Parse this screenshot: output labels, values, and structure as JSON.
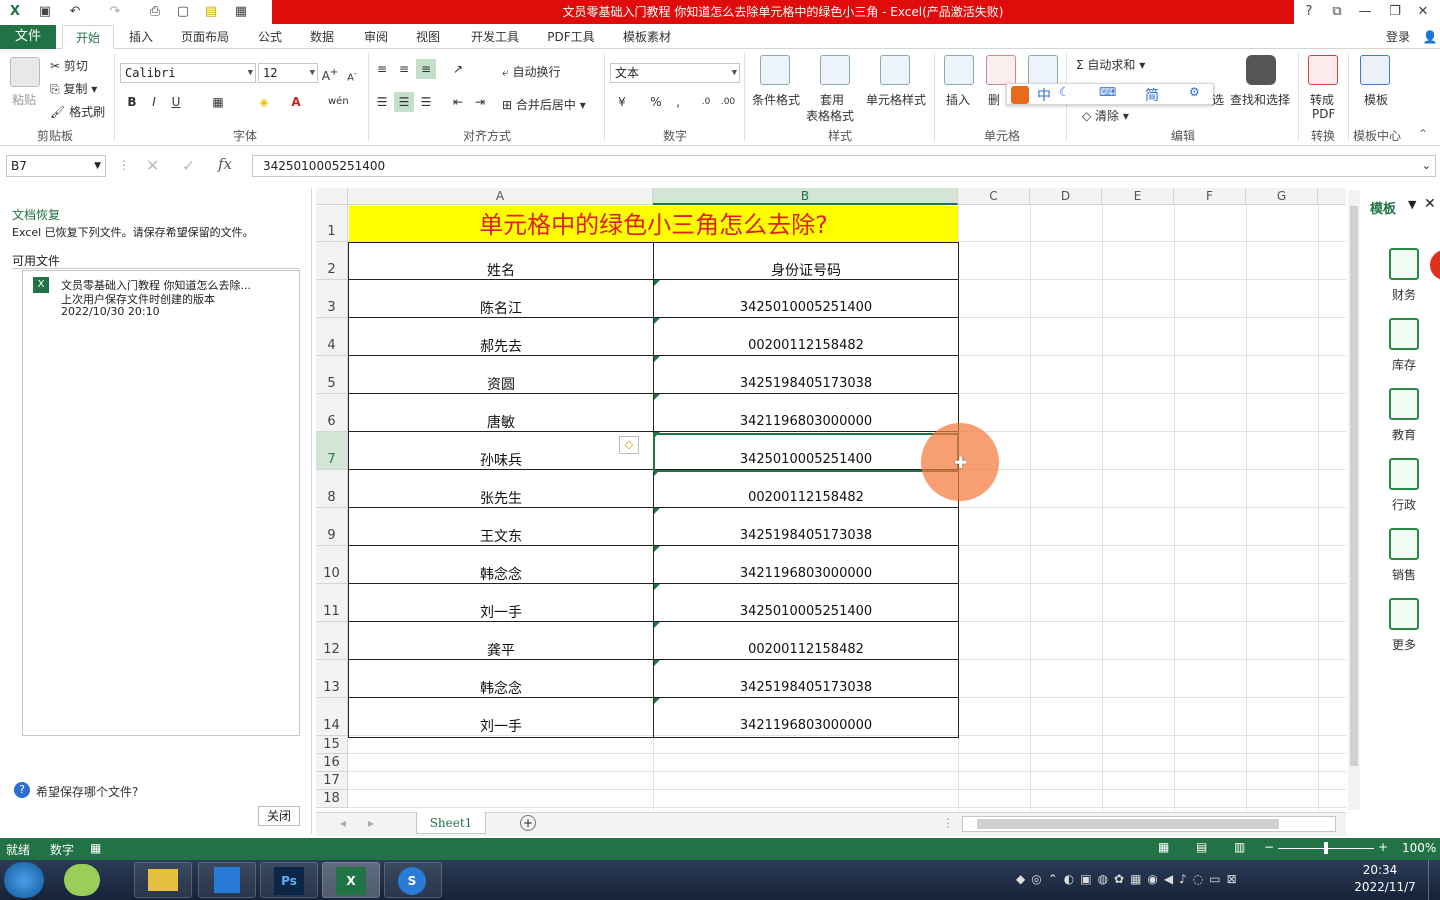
{
  "window": {
    "title": "文员零基础入门教程 你知道怎么去除单元格中的绿色小三角 - Excel(产品激活失败)",
    "help": "?",
    "colors": {
      "excel_green": "#217346",
      "title_red": "#e00c0c"
    }
  },
  "ribbon": {
    "file_tab": "文件",
    "tabs": [
      "开始",
      "插入",
      "页面布局",
      "公式",
      "数据",
      "审阅",
      "视图",
      "开发工具",
      "PDF工具",
      "模板素材"
    ],
    "login": "登录",
    "clipboard": {
      "paste": "粘贴",
      "cut": "剪切",
      "copy": "复制",
      "format_painter": "格式刷",
      "label": "剪贴板"
    },
    "font": {
      "name": "Calibri",
      "size": "12",
      "bold": "B",
      "italic": "I",
      "underline": "U",
      "label": "字体"
    },
    "alignment": {
      "wrap": "自动换行",
      "merge": "合并后居中",
      "label": "对齐方式"
    },
    "number": {
      "format": "文本",
      "label": "数字"
    },
    "styles": {
      "conditional": "条件格式",
      "table_format_1": "套用",
      "table_format_2": "表格格式",
      "cell_styles": "单元格样式",
      "label": "样式"
    },
    "cells": {
      "insert": "插入",
      "delete": "删",
      "label": "单元格"
    },
    "editing": {
      "autosum": "自动求和",
      "clear": "清除",
      "find": "查找和选择",
      "select_partial": "选",
      "label": "编辑"
    },
    "convert": {
      "to_pdf_1": "转成",
      "to_pdf_2": "PDF",
      "label": "转换"
    },
    "template": {
      "name": "模板",
      "label": "模板中心"
    },
    "float_toolbar": [
      "中",
      "简"
    ]
  },
  "formula_bar": {
    "name_box": "B7",
    "formula": "3425010005251400",
    "fx": "fx"
  },
  "recovery": {
    "title": "文档恢复",
    "desc": "Excel 已恢复下列文件。请保存希望保留的文件。",
    "available": "可用文件",
    "file_name": "文员零基础入门教程 你知道怎么去除...",
    "file_note": "上次用户保存文件时创建的版本",
    "file_time": "2022/10/30 20:10",
    "help_link": "希望保存哪个文件?",
    "close": "关闭"
  },
  "sheet": {
    "columns": [
      "A",
      "B",
      "C",
      "D",
      "E",
      "F",
      "G"
    ],
    "title": "单元格中的绿色小三角怎么去除?",
    "headers": [
      "姓名",
      "身份证号码"
    ],
    "rows": [
      {
        "row": "3",
        "name": "陈名江",
        "id": "3425010005251400"
      },
      {
        "row": "4",
        "name": "郝先去",
        "id": "00200112158482"
      },
      {
        "row": "5",
        "name": "资圆",
        "id": "3425198405173038"
      },
      {
        "row": "6",
        "name": "唐敏",
        "id": "3421196803000000"
      },
      {
        "row": "7",
        "name": "孙味兵",
        "id": "3425010005251400"
      },
      {
        "row": "8",
        "name": "张先生",
        "id": "00200112158482"
      },
      {
        "row": "9",
        "name": "王文东",
        "id": "3425198405173038"
      },
      {
        "row": "10",
        "name": "韩念念",
        "id": "3421196803000000"
      },
      {
        "row": "11",
        "name": "刘一手",
        "id": "3425010005251400"
      },
      {
        "row": "12",
        "name": "龚平",
        "id": "00200112158482"
      },
      {
        "row": "13",
        "name": "韩念念",
        "id": "3425198405173038"
      },
      {
        "row": "14",
        "name": "刘一手",
        "id": "3421196803000000"
      }
    ],
    "row_numbers": [
      "1",
      "2",
      "3",
      "4",
      "5",
      "6",
      "7",
      "8",
      "9",
      "10",
      "11",
      "12",
      "13",
      "14",
      "15",
      "16",
      "17",
      "18"
    ],
    "sheet_tab": "Sheet1",
    "title_bg": "#ffff00",
    "title_color": "#e02020"
  },
  "template_pane": {
    "title": "模板",
    "items": [
      "财务",
      "库存",
      "教育",
      "行政",
      "销售",
      "更多"
    ]
  },
  "status": {
    "ready": "就绪",
    "mode": "数字",
    "zoom": "100%"
  },
  "taskbar": {
    "time": "20:34",
    "date": "2022/11/7"
  }
}
